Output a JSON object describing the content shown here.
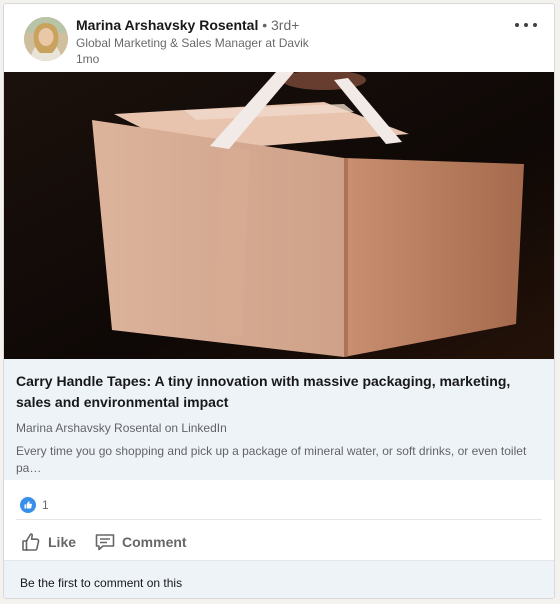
{
  "post": {
    "author": {
      "name": "Marina Arshavsky Rosental",
      "degree": " • 3rd+",
      "headline": "Global Marketing & Sales Manager at Davik",
      "time": "1mo"
    },
    "article": {
      "title": "Carry Handle Tapes: A tiny innovation with massive packaging, marketing, sales and environmental impact",
      "source": "Marina Arshavsky Rosental on LinkedIn",
      "excerpt": "Every time you go shopping and pick up a package of mineral water, or soft drinks, or even toilet pa…"
    },
    "reactions": {
      "count": "1",
      "icon": "like-reaction-icon"
    },
    "actions": {
      "like": "Like",
      "comment": "Comment"
    },
    "footer": {
      "text": "Be the first to comment on this"
    }
  },
  "colors": {
    "accent": "#0a66c2",
    "article_bg": "#eef3f8",
    "muted_text": "#666666"
  }
}
